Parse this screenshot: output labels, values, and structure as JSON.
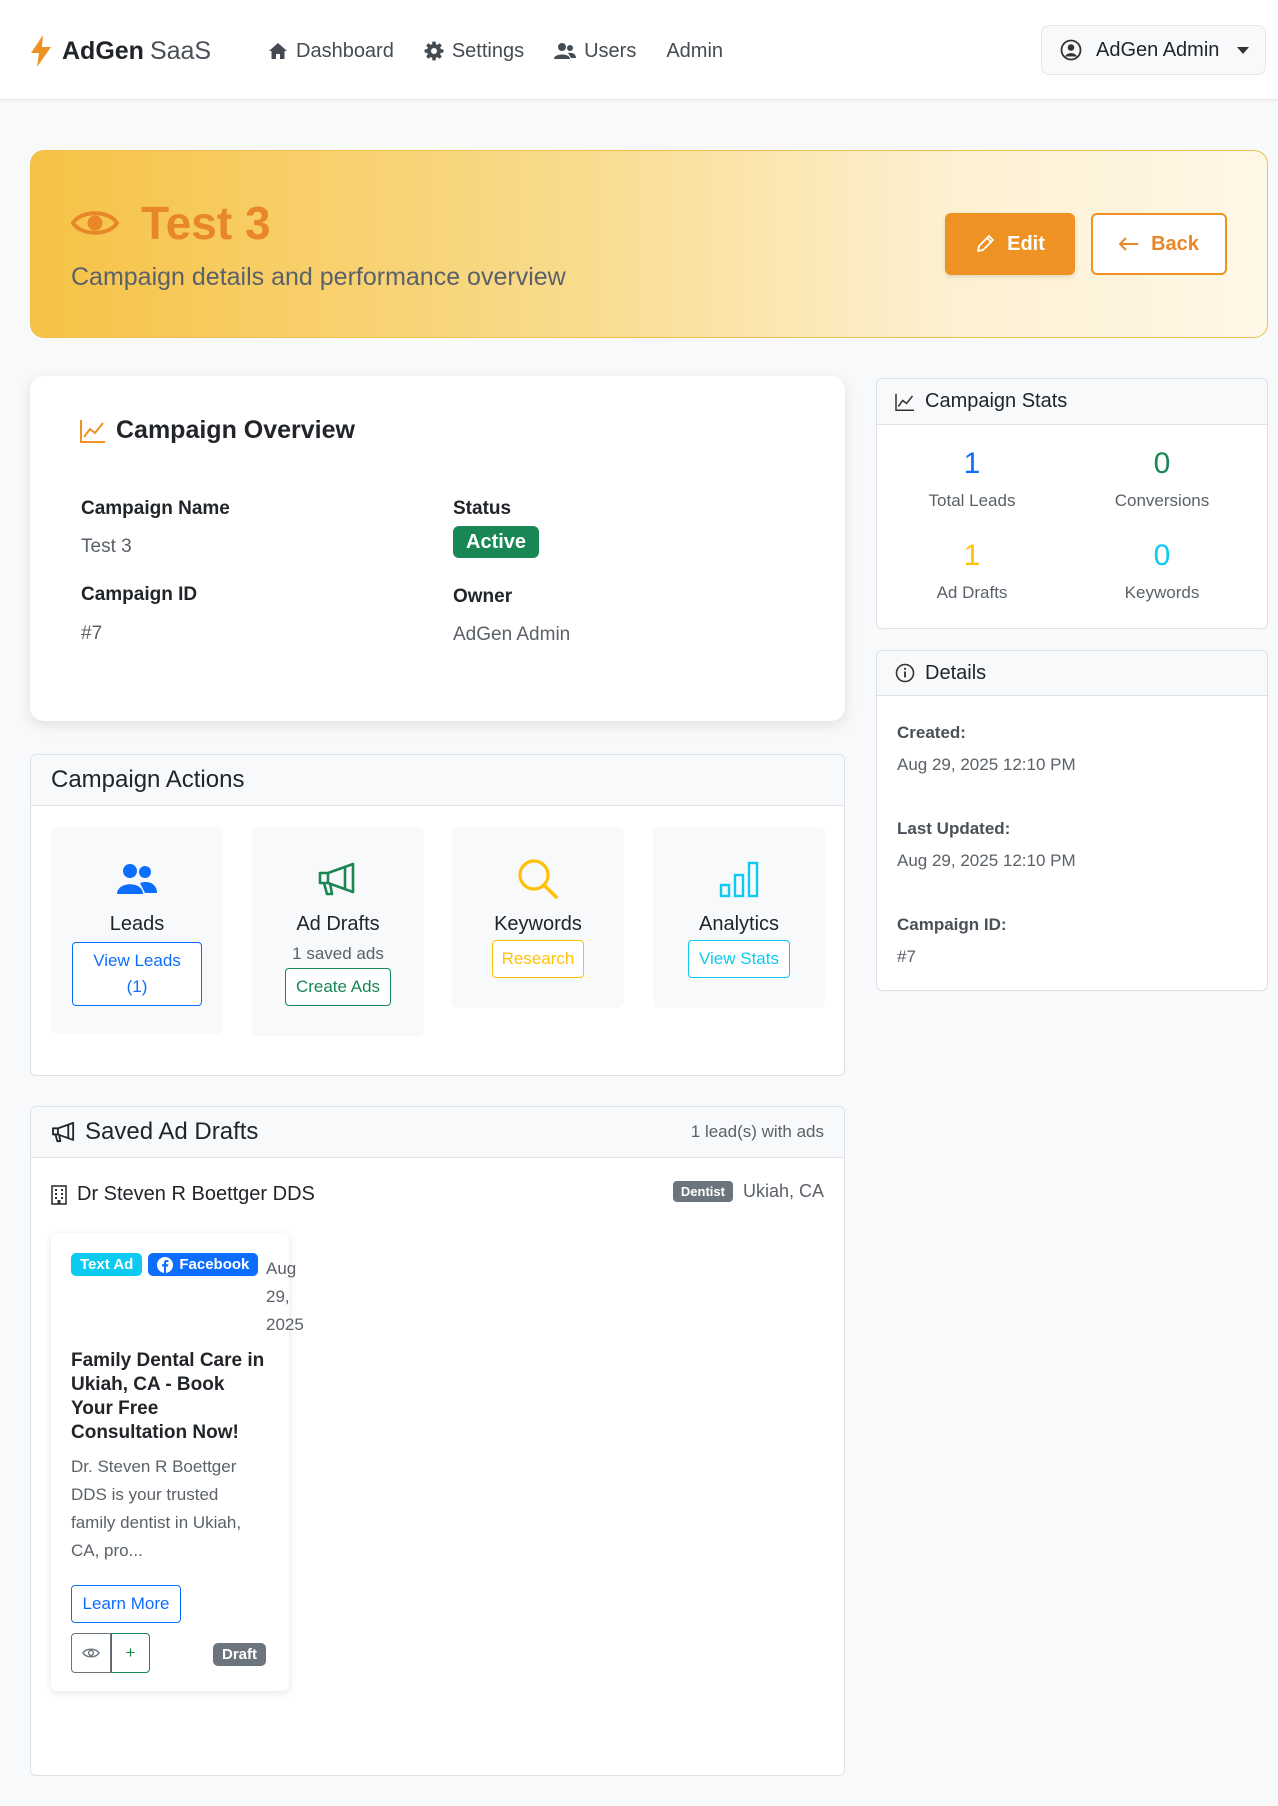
{
  "navbar": {
    "brand_name": "AdGen",
    "brand_suffix": "SaaS",
    "links": [
      "Dashboard",
      "Settings",
      "Users",
      "Admin"
    ],
    "user_label": "AdGen Admin"
  },
  "hero": {
    "title": "Test 3",
    "subtitle": "Campaign details and performance overview",
    "edit_label": "Edit",
    "back_label": "Back"
  },
  "overview": {
    "title": "Campaign Overview",
    "name_label": "Campaign Name",
    "name_value": "Test 3",
    "status_label": "Status",
    "status_value": "Active",
    "id_label": "Campaign ID",
    "id_value": "#7",
    "owner_label": "Owner",
    "owner_value": "AdGen Admin"
  },
  "actions": {
    "title": "Campaign Actions",
    "leads": {
      "name": "Leads",
      "button_line1": "View Leads",
      "button_line2": "(1)"
    },
    "drafts": {
      "name": "Ad Drafts",
      "sub": "1 saved ads",
      "button": "Create Ads"
    },
    "keywords": {
      "name": "Keywords",
      "button": "Research"
    },
    "analytics": {
      "name": "Analytics",
      "button": "View Stats"
    }
  },
  "saved_drafts": {
    "title": "Saved Ad Drafts",
    "count_text": "1 lead(s) with ads",
    "lead": {
      "name": "Dr Steven R Boettger DDS",
      "category": "Dentist",
      "location": "Ukiah, CA"
    },
    "ad": {
      "type_badge": "Text Ad",
      "platform_badge": "Facebook",
      "date_line1": "Aug",
      "date_line2": "29,",
      "date_line3": "2025",
      "headline": "Family Dental Care in Ukiah, CA - Book Your Free Consultation Now!",
      "body": "Dr. Steven R Boettger DDS is your trusted family dentist in Ukiah, CA, pro...",
      "cta": "Learn More",
      "status_badge": "Draft",
      "plus_label": "+"
    }
  },
  "stats": {
    "title": "Campaign Stats",
    "total_leads": {
      "value": "1",
      "label": "Total Leads",
      "color": "#0d6efd"
    },
    "conversions": {
      "value": "0",
      "label": "Conversions",
      "color": "#198754"
    },
    "ad_drafts": {
      "value": "1",
      "label": "Ad Drafts",
      "color": "#ffc107"
    },
    "keywords": {
      "value": "0",
      "label": "Keywords",
      "color": "#0dcaf0"
    }
  },
  "details": {
    "title": "Details",
    "created_label": "Created:",
    "created_value": "Aug 29, 2025 12:10 PM",
    "updated_label": "Last Updated:",
    "updated_value": "Aug 29, 2025 12:10 PM",
    "id_label": "Campaign ID:",
    "id_value": "#7"
  },
  "colors": {
    "accent": "#ee9323",
    "success": "#198754",
    "primary": "#0d6efd",
    "warning": "#ffc107",
    "info": "#0dcaf0",
    "secondary": "#6c757d"
  }
}
